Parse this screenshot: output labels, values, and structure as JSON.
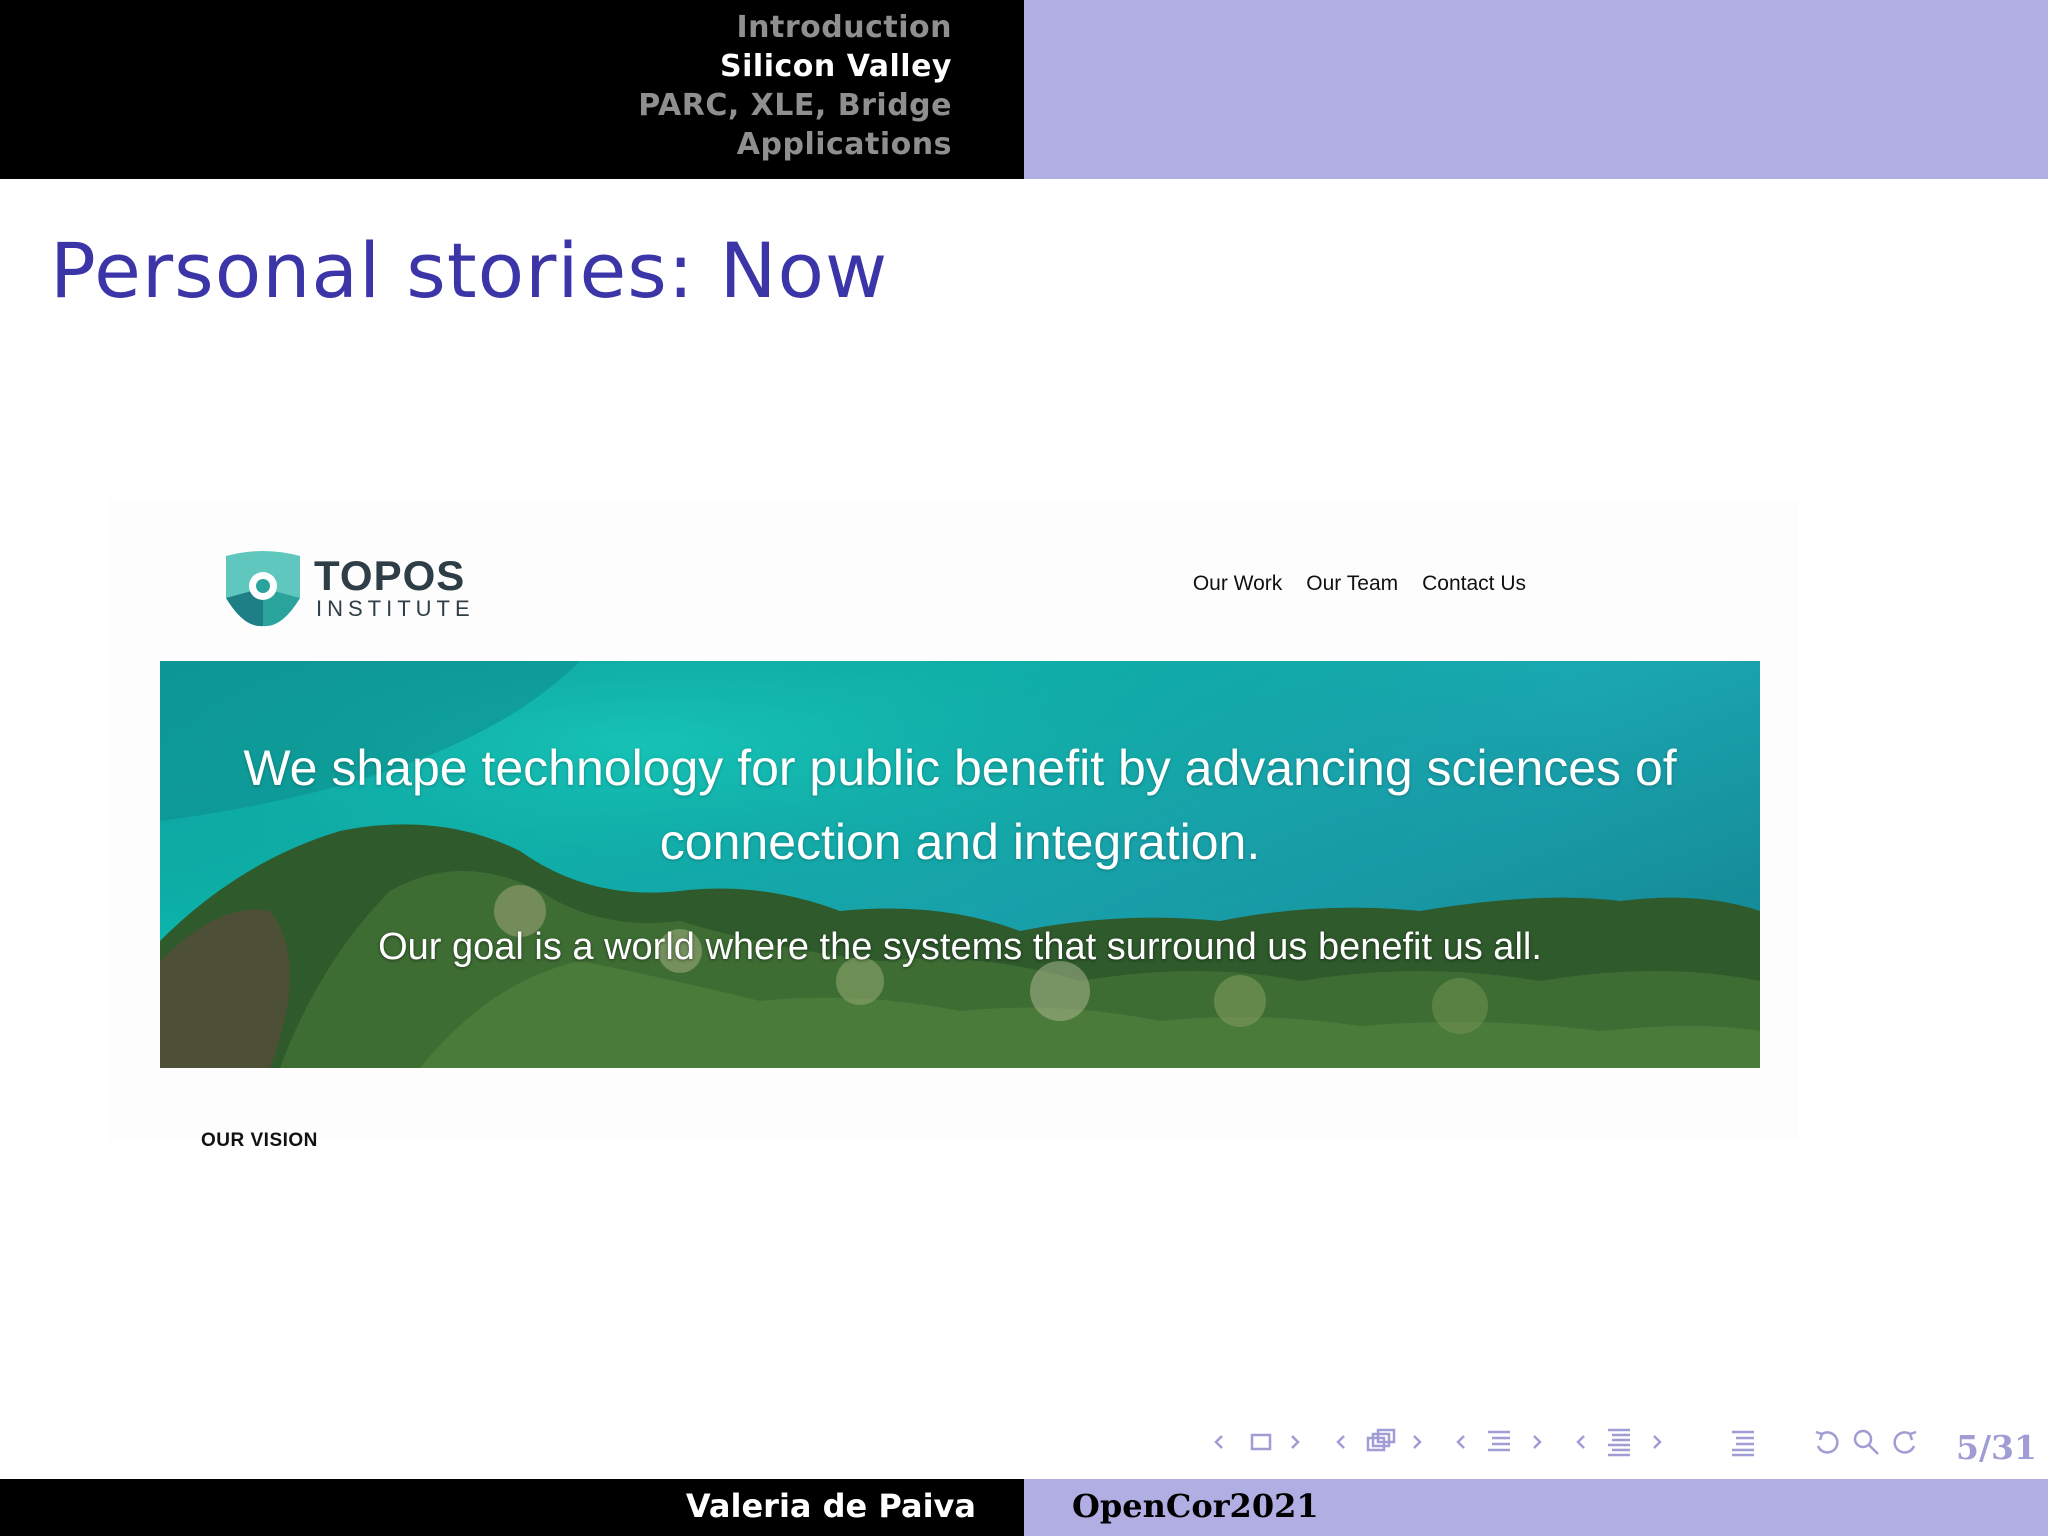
{
  "header": {
    "sections": [
      {
        "label": "Introduction",
        "active": false
      },
      {
        "label": "Silicon Valley",
        "active": true
      },
      {
        "label": "PARC, XLE, Bridge",
        "active": false
      },
      {
        "label": "Applications",
        "active": false
      }
    ]
  },
  "frame": {
    "title": "Personal stories: Now"
  },
  "website": {
    "logo": {
      "word": "TOPOS",
      "sub": "INSTITUTE",
      "icon": "topos-logo-icon"
    },
    "nav": [
      {
        "label": "Our Work"
      },
      {
        "label": "Our Team"
      },
      {
        "label": "Contact Us"
      }
    ],
    "hero": {
      "line1": "We shape technology for public benefit by advancing sciences of",
      "line2": "connection and integration.",
      "subtitle": "Our goal is a world where the systems that surround us benefit us all."
    },
    "section_heading": "OUR VISION"
  },
  "navigation": {
    "icons": [
      "nav-slide-icon",
      "nav-frame-icon",
      "nav-subsection-icon",
      "nav-section-icon",
      "nav-doc-icon",
      "nav-back-icon",
      "nav-search-icon",
      "nav-forward-icon"
    ],
    "page": "5/31"
  },
  "footer": {
    "author": "Valeria de Paiva",
    "event": "OpenCor2021"
  },
  "colors": {
    "title": "#3b35a8",
    "bar_dark": "#000000",
    "bar_light": "#b0aee2",
    "nav_symbols": "#9f9dd4",
    "hero_teal": "#0db8ad"
  }
}
